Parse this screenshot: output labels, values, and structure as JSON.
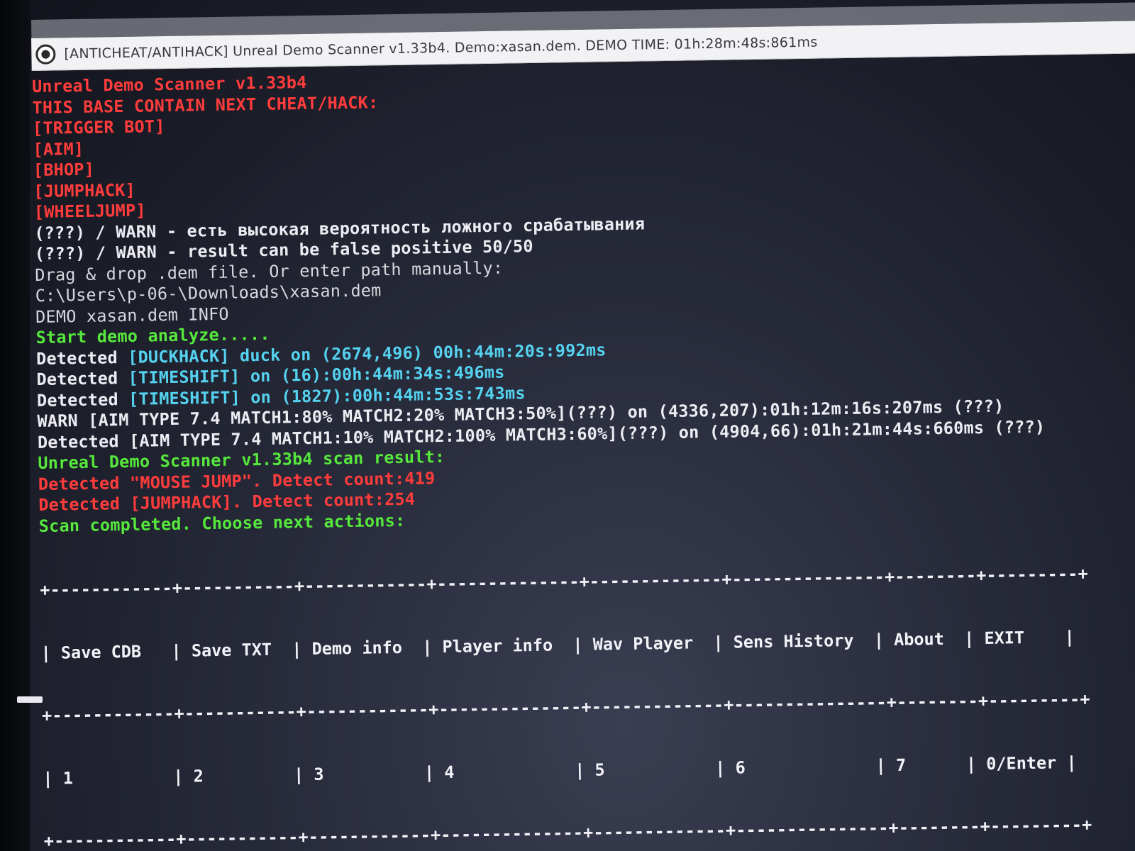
{
  "window": {
    "title": "[ANTICHEAT/ANTIHACK] Unreal Demo Scanner v1.33b4. Demo:xasan.dem. DEMO TIME: 01h:28m:48s:861ms"
  },
  "console": {
    "header": [
      "Unreal Demo Scanner v1.33b4",
      "THIS BASE CONTAIN NEXT CHEAT/HACK:",
      "[TRIGGER BOT]",
      "[AIM]",
      "[BHOP]",
      "[JUMPHACK]",
      "[WHEELJUMP]"
    ],
    "warn_ru": "(???) / WARN - есть высокая вероятность ложного срабатывания",
    "warn_en": "(???) / WARN - result can be false positive 50/50",
    "prompt": "Drag & drop .dem file. Or enter path manually:",
    "path": "C:\\Users\\p-06-\\Downloads\\xasan.dem",
    "demo_info": "DEMO xasan.dem INFO",
    "start": "Start demo analyze.....",
    "detections": [
      {
        "label": "Detected ",
        "rest": "[DUCKHACK] duck on (2674,496) 00h:44m:20s:992ms"
      },
      {
        "label": "Detected ",
        "rest": "[TIMESHIFT] on (16):00h:44m:34s:496ms"
      },
      {
        "label": "Detected ",
        "rest": "[TIMESHIFT] on (1827):00h:44m:53s:743ms"
      }
    ],
    "warn_aim": "WARN [AIM TYPE 7.4 MATCH1:80% MATCH2:20% MATCH3:50%](???) on (4336,207):01h:12m:16s:207ms (???)",
    "detected_aim": "Detected [AIM TYPE 7.4 MATCH1:10% MATCH2:100% MATCH3:60%](???) on (4904,66):01h:21m:44s:660ms (???)",
    "scan_result": "Unreal Demo Scanner v1.33b4 scan result:",
    "result_lines": [
      "Detected \"MOUSE JUMP\". Detect count:419",
      "Detected [JUMPHACK]. Detect count:254"
    ],
    "completed": "Scan completed. Choose next actions:"
  },
  "menu": {
    "items": [
      {
        "label": "Save CDB",
        "key": "1"
      },
      {
        "label": "Save TXT",
        "key": "2"
      },
      {
        "label": "Demo info",
        "key": "3"
      },
      {
        "label": "Player info",
        "key": "4"
      },
      {
        "label": "Wav Player",
        "key": "5"
      },
      {
        "label": "Sens History",
        "key": "6"
      },
      {
        "label": "About",
        "key": "7"
      },
      {
        "label": "EXIT",
        "key": "0/Enter"
      }
    ]
  },
  "colors": {
    "red": "#ff3c3c",
    "green": "#56e83c",
    "cyan": "#54d2f0",
    "white": "#ececf2"
  }
}
